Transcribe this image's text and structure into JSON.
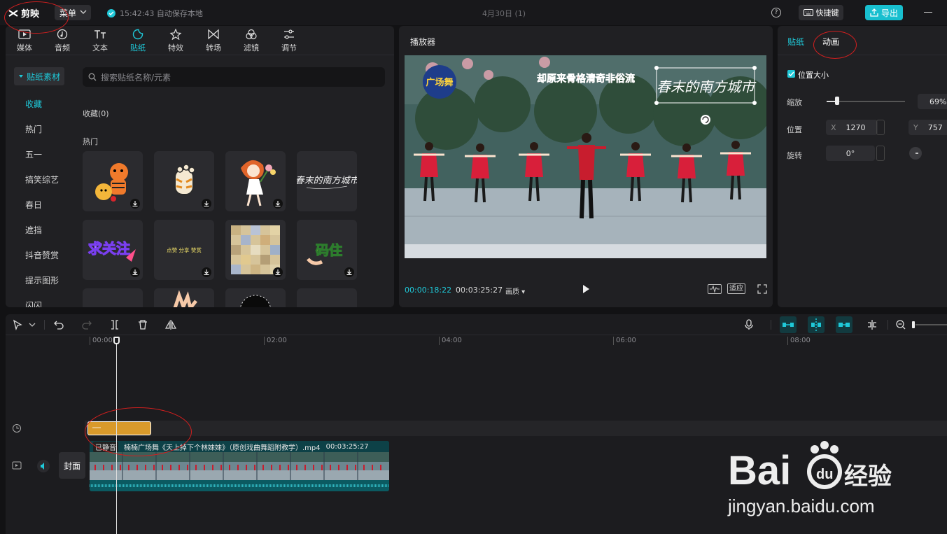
{
  "topbar": {
    "app_name": "剪映",
    "menu_label": "菜单",
    "autosave_text": "15:42:43 自动保存本地",
    "doc_title": "4月30日 (1)",
    "help_label": "?",
    "shortcut_label": "快捷键",
    "export_label": "导出"
  },
  "tool_tabs": [
    {
      "label": "媒体",
      "icon": "media-icon"
    },
    {
      "label": "音频",
      "icon": "audio-icon"
    },
    {
      "label": "文本",
      "icon": "text-icon"
    },
    {
      "label": "贴纸",
      "icon": "sticker-icon",
      "active": true
    },
    {
      "label": "特效",
      "icon": "effects-icon"
    },
    {
      "label": "转场",
      "icon": "transition-icon"
    },
    {
      "label": "滤镜",
      "icon": "filter-icon"
    },
    {
      "label": "调节",
      "icon": "adjust-icon"
    }
  ],
  "sticker_panel": {
    "category_head": "贴纸素材",
    "categories": [
      "收藏",
      "热门",
      "五一",
      "搞笑综艺",
      "春日",
      "遮挡",
      "抖音赞赏",
      "提示图形",
      "闪闪"
    ],
    "search_placeholder": "搜索贴纸名称/元素",
    "favorites_label": "收藏(0)",
    "hot_label": "热门",
    "stickers": [
      {
        "name": "tiger-cartoon"
      },
      {
        "name": "tiger-paw"
      },
      {
        "name": "girl-with-flowers"
      },
      {
        "name": "spring-calligraphy",
        "text": "春末的南方城市"
      },
      {
        "name": "ask-follow",
        "text": "求关注"
      },
      {
        "name": "like-share-banner",
        "text": "点赞 分享 赞赏"
      },
      {
        "name": "mosaic"
      },
      {
        "name": "bookmark-it",
        "text": "码住"
      }
    ]
  },
  "player": {
    "title": "播放器",
    "overlay_caption": "却原来骨格清奇非俗流",
    "overlay_logo": "广场舞",
    "overlay_sticker": "春末的南方城市",
    "current_time": "00:00:18:22",
    "total_time": "00:03:25:27",
    "quality_label": "画质",
    "fit_label": "适应"
  },
  "inspector": {
    "tab_sticker": "贴纸",
    "tab_animation": "动画",
    "section_label": "位置大小",
    "scale_label": "缩放",
    "scale_value": "69%",
    "position_label": "位置",
    "pos_x_label": "X",
    "pos_x_value": "1270",
    "pos_y_label": "Y",
    "pos_y_value": "757",
    "rotate_label": "旋转",
    "rotate_value": "0°"
  },
  "timeline": {
    "ruler_ticks": [
      "00:00",
      "02:00",
      "04:00",
      "06:00",
      "08:00"
    ],
    "cover_label": "封面",
    "clip_muted_label": "已静音",
    "clip_name": "楠楠广场舞《天上掉下个林妹妹》（原创戏曲舞蹈附教学）.mp4",
    "clip_duration": "00:03:25:27"
  },
  "watermark": {
    "brand": "Baidu经验",
    "url": "jingyan.baidu.com"
  },
  "colors": {
    "accent": "#1fc8d8",
    "panel": "#202023",
    "background": "#121214",
    "sticker_clip": "#d99a2b",
    "annotation": "#d21f1f"
  }
}
